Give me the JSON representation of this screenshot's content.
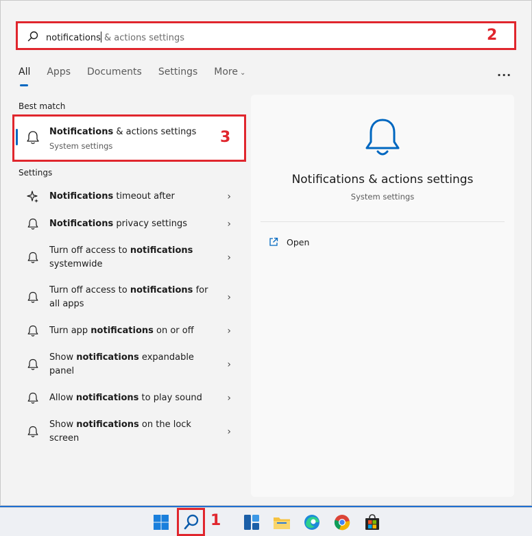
{
  "search": {
    "typed": "notifications",
    "suggestion": " & actions settings"
  },
  "tabs": [
    {
      "label": "All",
      "active": true
    },
    {
      "label": "Apps"
    },
    {
      "label": "Documents"
    },
    {
      "label": "Settings"
    },
    {
      "label": "More"
    }
  ],
  "more_menu": "...",
  "best_match": {
    "section_label": "Best match",
    "title_bold": "Notifications",
    "title_rest": " & actions settings",
    "subtitle": "System settings"
  },
  "settings_section": {
    "label": "Settings",
    "items": [
      {
        "pre": "",
        "bold": "Notifications",
        "post": " timeout after",
        "icon": "sparkle-icon"
      },
      {
        "pre": "",
        "bold": "Notifications",
        "post": " privacy settings",
        "icon": "bell-icon"
      },
      {
        "pre": "Turn off access to ",
        "bold": "notifications",
        "post": " systemwide",
        "icon": "bell-icon"
      },
      {
        "pre": "Turn off access to ",
        "bold": "notifications",
        "post": " for all apps",
        "icon": "bell-icon"
      },
      {
        "pre": "Turn app ",
        "bold": "notifications",
        "post": " on or off",
        "icon": "bell-icon"
      },
      {
        "pre": "Show ",
        "bold": "notifications",
        "post": " expandable panel",
        "icon": "bell-icon"
      },
      {
        "pre": "Allow ",
        "bold": "notifications",
        "post": " to play sound",
        "icon": "bell-icon"
      },
      {
        "pre": "Show ",
        "bold": "notifications",
        "post": " on the lock screen",
        "icon": "bell-icon"
      }
    ]
  },
  "preview": {
    "title": "Notifications & actions settings",
    "subtitle": "System settings",
    "open_label": "Open"
  },
  "annotations": {
    "one": "1",
    "two": "2",
    "three": "3"
  },
  "colors": {
    "accent": "#0067c0",
    "annotation_red": "#e0262d"
  }
}
